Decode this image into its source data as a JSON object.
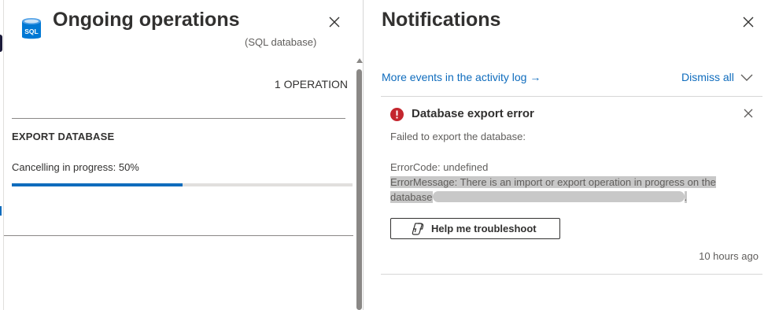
{
  "ongoing_operations": {
    "title": "Ongoing operations",
    "subtitle": "(SQL database)",
    "operation_count": "1 OPERATION",
    "operation": {
      "name": "EXPORT DATABASE",
      "status": "Cancelling in progress: 50%",
      "progress_fraction": 0.5
    }
  },
  "notifications": {
    "title": "Notifications",
    "activity_link": "More events in the activity log",
    "activity_arrow": "→",
    "dismiss_all": "Dismiss all",
    "item": {
      "title": "Database export error",
      "description": "Failed to export the database:",
      "error_code": "ErrorCode: undefined",
      "error_message": "ErrorMessage: There is an import or export operation in progress on the database",
      "error_message_end": ".",
      "help_button": "Help me troubleshoot",
      "timestamp": "10 hours ago"
    }
  },
  "colors": {
    "accent": "#0f6cbd",
    "error": "#c4262e",
    "sql_icon": "#0078d4",
    "highlight": "#c8c8c8"
  },
  "icons": {
    "sql": "sql-database-icon",
    "close": "close-icon",
    "error": "error-icon",
    "chevron": "chevron-down-icon",
    "copilot": "copilot-icon"
  }
}
